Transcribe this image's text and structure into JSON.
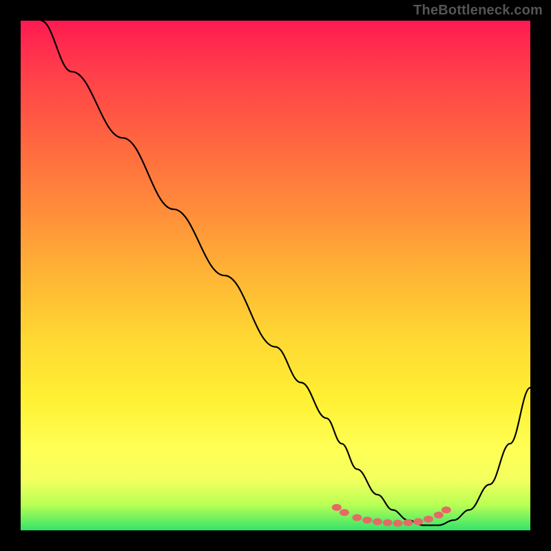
{
  "watermark": "TheBottleneck.com",
  "chart_data": {
    "type": "line",
    "title": "",
    "xlabel": "",
    "ylabel": "",
    "xlim": [
      0,
      100
    ],
    "ylim": [
      0,
      100
    ],
    "gradient_stops": [
      {
        "pct": 0,
        "color": "#ff1a52"
      },
      {
        "pct": 10,
        "color": "#ff3e4a"
      },
      {
        "pct": 25,
        "color": "#ff6a3f"
      },
      {
        "pct": 38,
        "color": "#ff8f3a"
      },
      {
        "pct": 50,
        "color": "#ffb535"
      },
      {
        "pct": 62,
        "color": "#ffd733"
      },
      {
        "pct": 74,
        "color": "#fff033"
      },
      {
        "pct": 84,
        "color": "#ffff55"
      },
      {
        "pct": 90,
        "color": "#f4ff5e"
      },
      {
        "pct": 95,
        "color": "#b8ff54"
      },
      {
        "pct": 100,
        "color": "#33e36b"
      }
    ],
    "series": [
      {
        "name": "curve",
        "color": "#000000",
        "x": [
          4,
          10,
          20,
          30,
          40,
          50,
          55,
          60,
          63,
          66,
          70,
          73,
          76,
          79,
          82,
          85,
          88,
          92,
          96,
          100
        ],
        "values": [
          100,
          90,
          77,
          63,
          50,
          36,
          29,
          22,
          17,
          12,
          7,
          4,
          2,
          1,
          1,
          2,
          4,
          9,
          17,
          28
        ]
      }
    ],
    "markers": {
      "name": "dots",
      "color": "#e46a67",
      "x": [
        62,
        63.5,
        66,
        68,
        70,
        72,
        74,
        76,
        78,
        80,
        82,
        83.5
      ],
      "y": [
        4.5,
        3.5,
        2.5,
        2.0,
        1.7,
        1.5,
        1.4,
        1.5,
        1.7,
        2.2,
        3.0,
        4.0
      ]
    }
  }
}
